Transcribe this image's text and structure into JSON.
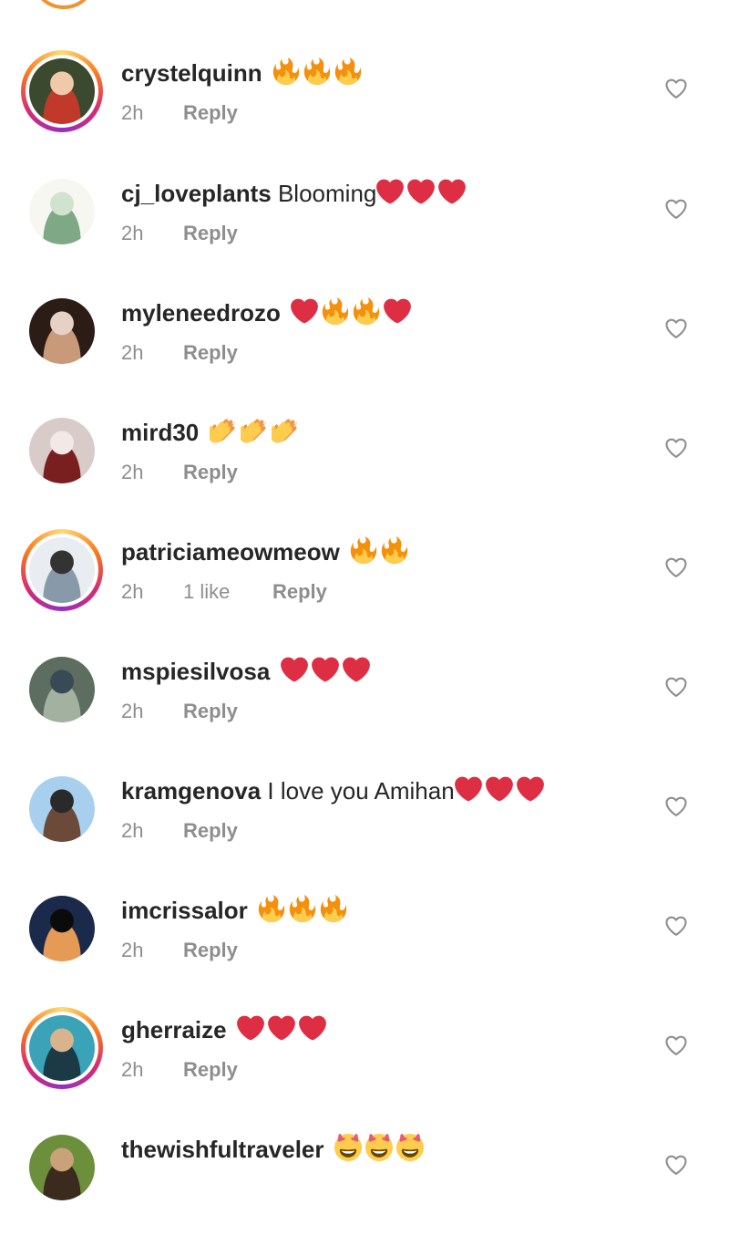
{
  "comments": [
    {
      "username": "crystelquinn",
      "text": "",
      "emojis": [
        "fire",
        "fire",
        "fire"
      ],
      "time": "2h",
      "likes": "",
      "reply_label": "Reply",
      "story_ring": true,
      "avatar_colors": [
        "#3b4a2e",
        "#c0392b",
        "#f0c9a8"
      ]
    },
    {
      "username": "cj_loveplants",
      "text": "Blooming",
      "emojis": [
        "heart",
        "heart",
        "heart"
      ],
      "time": "2h",
      "likes": "",
      "reply_label": "Reply",
      "story_ring": false,
      "avatar_colors": [
        "#f7f7f2",
        "#7fa886",
        "#cfe3cf"
      ]
    },
    {
      "username": "myleneedrozo",
      "text": "",
      "emojis": [
        "heart",
        "fire",
        "fire",
        "heart"
      ],
      "time": "2h",
      "likes": "",
      "reply_label": "Reply",
      "story_ring": false,
      "avatar_colors": [
        "#2b1c16",
        "#c99a7a",
        "#e6d1c4"
      ]
    },
    {
      "username": "mird30",
      "text": "",
      "emojis": [
        "clap",
        "clap",
        "clap"
      ],
      "time": "2h",
      "likes": "",
      "reply_label": "Reply",
      "story_ring": false,
      "avatar_colors": [
        "#d9cbc8",
        "#7a1f1f",
        "#f2e8e6"
      ]
    },
    {
      "username": "patriciameowmeow",
      "text": "",
      "emojis": [
        "fire",
        "fire"
      ],
      "time": "2h",
      "likes": "1 like",
      "reply_label": "Reply",
      "story_ring": true,
      "avatar_colors": [
        "#e9edf2",
        "#8899aa",
        "#333333"
      ]
    },
    {
      "username": "mspiesilvosa",
      "text": "",
      "emojis": [
        "heart",
        "heart",
        "heart"
      ],
      "time": "2h",
      "likes": "",
      "reply_label": "Reply",
      "story_ring": false,
      "avatar_colors": [
        "#5d6d60",
        "#a3b1a0",
        "#384a55"
      ]
    },
    {
      "username": "kramgenova",
      "text": "I love you Amihan",
      "emojis": [
        "heart",
        "heart",
        "heart"
      ],
      "time": "2h",
      "likes": "",
      "reply_label": "Reply",
      "story_ring": false,
      "avatar_colors": [
        "#a8d0ee",
        "#6b4a3a",
        "#2a2a2a"
      ]
    },
    {
      "username": "imcrissalor",
      "text": "",
      "emojis": [
        "fire",
        "fire",
        "fire"
      ],
      "time": "2h",
      "likes": "",
      "reply_label": "Reply",
      "story_ring": false,
      "avatar_colors": [
        "#1b2a4a",
        "#e59a55",
        "#0b0b0b"
      ]
    },
    {
      "username": "gherraize",
      "text": "",
      "emojis": [
        "heart",
        "heart",
        "heart"
      ],
      "time": "2h",
      "likes": "",
      "reply_label": "Reply",
      "story_ring": true,
      "avatar_colors": [
        "#3aa3b8",
        "#1b3a46",
        "#d9b38c"
      ]
    },
    {
      "username": "thewishfultraveler",
      "text": "",
      "emojis": [
        "heart-eyes",
        "heart-eyes",
        "heart-eyes"
      ],
      "time": "",
      "likes": "",
      "reply_label": "",
      "story_ring": false,
      "avatar_colors": [
        "#6b8f3a",
        "#3b2a1e",
        "#c9a27a"
      ]
    }
  ],
  "icons": {
    "like": "heart-outline-icon"
  },
  "colors": {
    "text": "#262626",
    "meta": "#8e8e8e",
    "heart_red": "#e0245e",
    "fire_orange": "#f4900c",
    "clap_yellow": "#ffcc4d"
  }
}
